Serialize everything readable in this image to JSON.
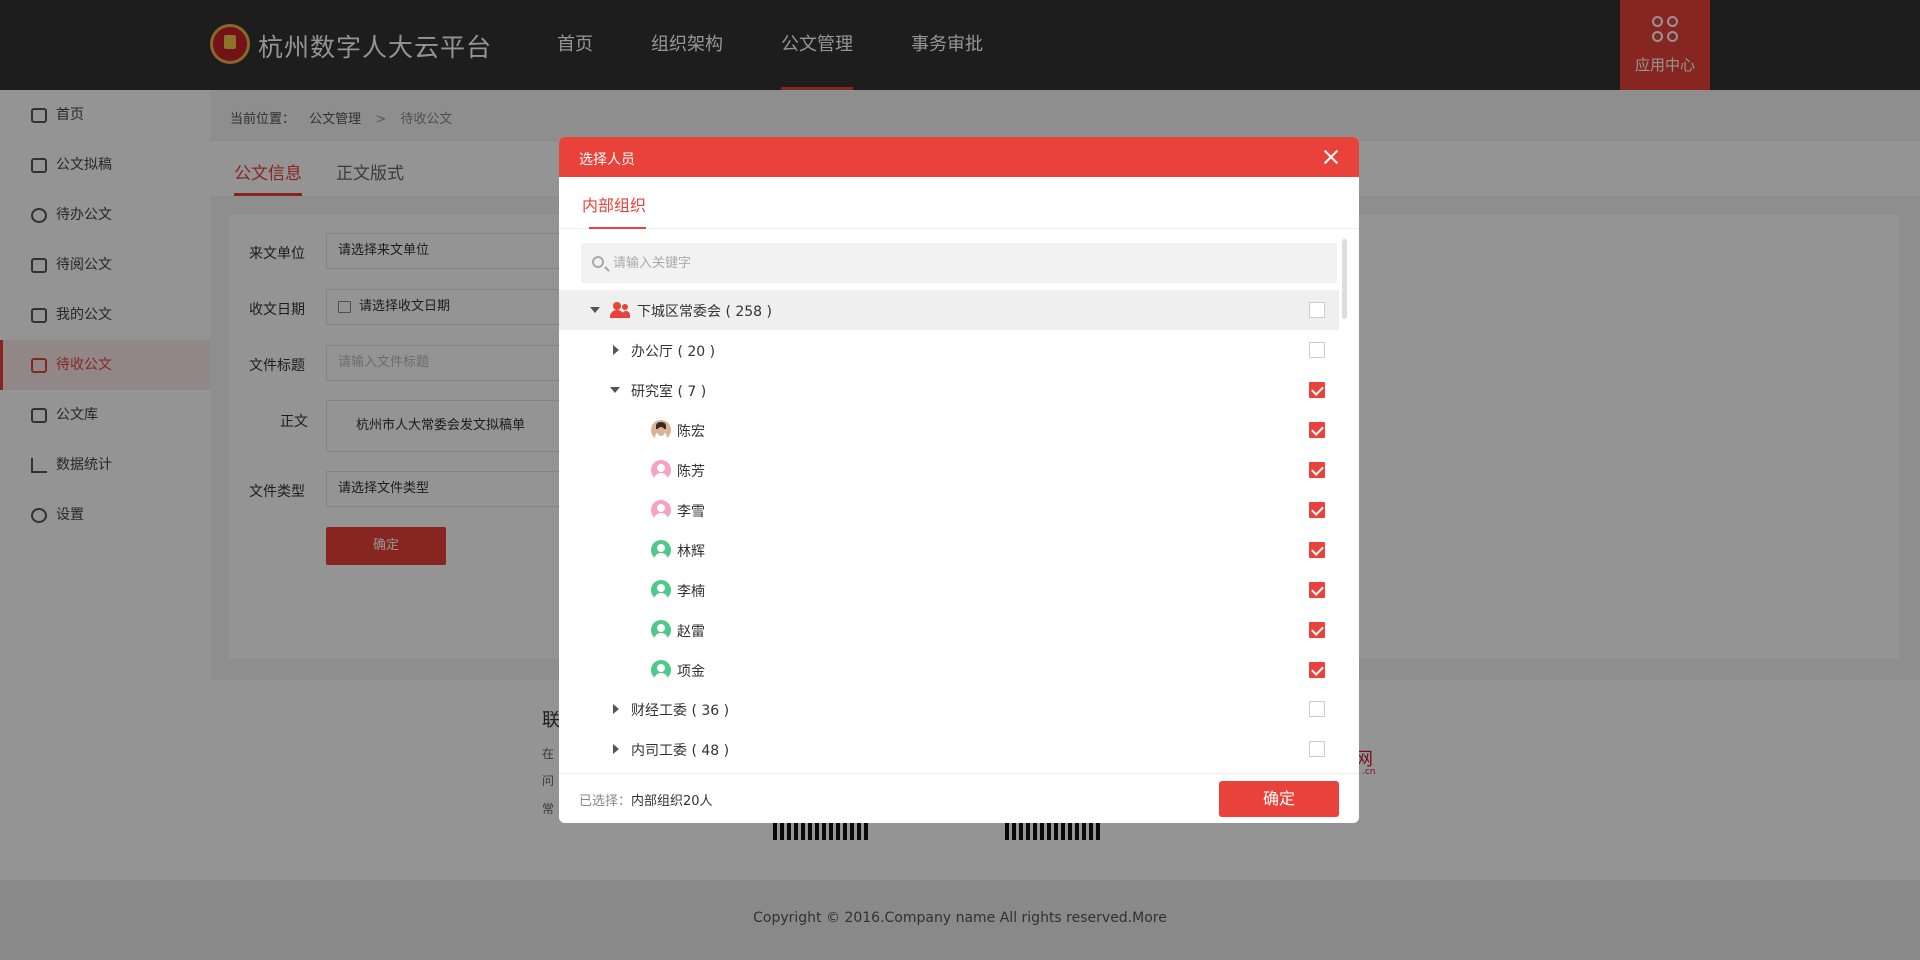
{
  "header": {
    "title": "杭州数字人大云平台",
    "nav": [
      {
        "label": "首页"
      },
      {
        "label": "组织架构"
      },
      {
        "label": "公文管理"
      },
      {
        "label": "事务审批"
      }
    ],
    "active_nav": "公文管理",
    "app_center_label": "应用中心"
  },
  "sidebar": {
    "items": [
      {
        "label": "首页",
        "icon": "home-icon"
      },
      {
        "label": "公文拟稿",
        "icon": "edit-icon"
      },
      {
        "label": "待办公文",
        "icon": "check-circle-icon"
      },
      {
        "label": "待阅公文",
        "icon": "document-icon"
      },
      {
        "label": "我的公文",
        "icon": "book-icon"
      },
      {
        "label": "待收公文",
        "icon": "list-document-icon"
      },
      {
        "label": "公文库",
        "icon": "folder-icon"
      },
      {
        "label": "数据统计",
        "icon": "chart-icon"
      },
      {
        "label": "设置",
        "icon": "settings-icon"
      }
    ],
    "active_item": "待收公文"
  },
  "breadcrumb": {
    "prefix": "当前位置：",
    "items": [
      "公文管理",
      ">",
      "待收公文"
    ]
  },
  "tabs": [
    {
      "label": "公文信息"
    },
    {
      "label": "正文版式"
    }
  ],
  "form": {
    "source_label": "来文单位",
    "source_value": "请选择来文单位",
    "date_label": "收文日期",
    "date_value": "请选择收文日期",
    "title_label": "文件标题",
    "title_placeholder": "请输入文件标题",
    "body_label": "正文",
    "body_value": "杭州市人大常委会发文拟稿单",
    "type_label": "文件类型",
    "type_value": "请选择文件类型",
    "submit_label": "确定"
  },
  "footer": {
    "heading_fragment": "联",
    "lines": [
      "在",
      "问",
      "常"
    ],
    "brand_fragment": "网",
    "brand_sub": ".cn",
    "copyright": "Copyright © 2016.Company name All rights reserved.More"
  },
  "modal": {
    "title": "选择人员",
    "tab": "内部组织",
    "search_placeholder": "请输入关键字",
    "root": {
      "label": "下城区常委会 ( 258 )",
      "checked": false
    },
    "groups": [
      {
        "label": "办公厅 ( 20 )",
        "checked": false
      },
      {
        "label": "研究室 ( 7 )",
        "checked": true
      }
    ],
    "people": [
      {
        "name": "陈宏",
        "avatar": "photo",
        "checked": true
      },
      {
        "name": "陈芳",
        "avatar": "pink",
        "checked": true
      },
      {
        "name": "李雪",
        "avatar": "pink",
        "checked": true
      },
      {
        "name": "林辉",
        "avatar": "green",
        "checked": true
      },
      {
        "name": "李楠",
        "avatar": "green",
        "checked": true
      },
      {
        "name": "赵雷",
        "avatar": "green",
        "checked": true
      },
      {
        "name": "项金",
        "avatar": "green",
        "checked": true
      }
    ],
    "more_groups": [
      {
        "label": "财经工委 ( 36 )",
        "checked": false
      },
      {
        "label": "内司工委 ( 48 )",
        "checked": false
      }
    ],
    "selected_prefix": "已选择：",
    "selected_value": "内部组织20人",
    "confirm_label": "确定"
  },
  "colors": {
    "accent": "#e8423a",
    "header_bg": "#333333",
    "female_avatar": "#f7a1c4",
    "male_avatar": "#4fc98a"
  }
}
